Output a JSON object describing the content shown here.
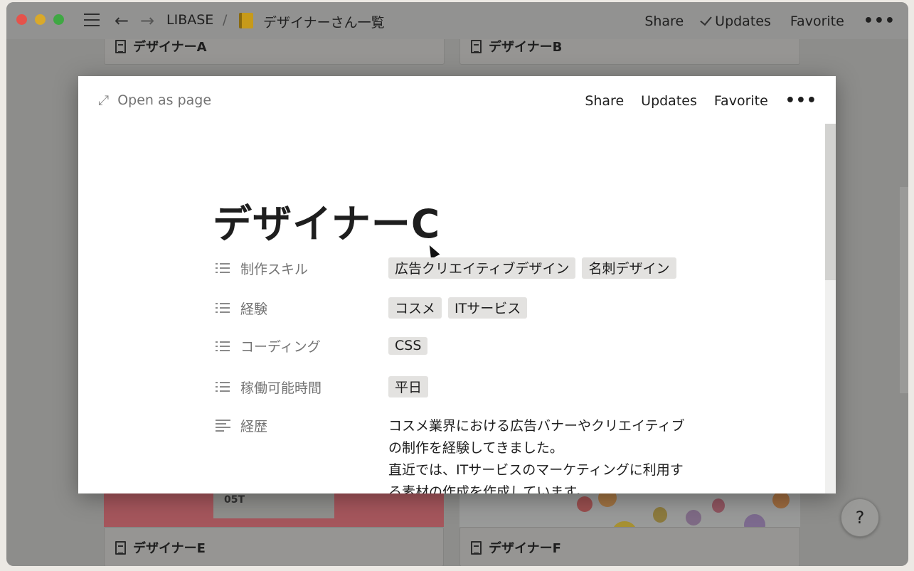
{
  "titlebar": {
    "breadcrumb_workspace": "LIBASE",
    "breadcrumb_separator": "/",
    "breadcrumb_page": "デザイナーさん一覧",
    "share": "Share",
    "updates": "Updates",
    "favorite": "Favorite",
    "more": "•••"
  },
  "background_cards": {
    "card_a": "デザイナーA",
    "card_b": "デザイナーB",
    "card_e": "デザイナーE",
    "card_f": "デザイナーF",
    "card_e_image_text": "05T"
  },
  "help_button": "?",
  "modal": {
    "open_as_page": "Open as page",
    "share": "Share",
    "updates": "Updates",
    "favorite": "Favorite",
    "more": "•••",
    "title": "デザイナーC",
    "properties": [
      {
        "name": "制作スキル",
        "tags": [
          "広告クリエイティブデザイン",
          "名刺デザイン"
        ]
      },
      {
        "name": "経験",
        "tags": [
          "コスメ",
          "ITサービス"
        ]
      },
      {
        "name": "コーディング",
        "tags": [
          "CSS"
        ]
      },
      {
        "name": "稼働可能時間",
        "tags": [
          "平日"
        ]
      }
    ],
    "history": {
      "name": "経歴",
      "lines": [
        "コスメ業界における広告バナーやクリエイティブ",
        "の制作を経験してきました。",
        "直近では、ITサービスのマーケティングに利用す",
        "る素材の作成を作成しています。"
      ]
    }
  }
}
